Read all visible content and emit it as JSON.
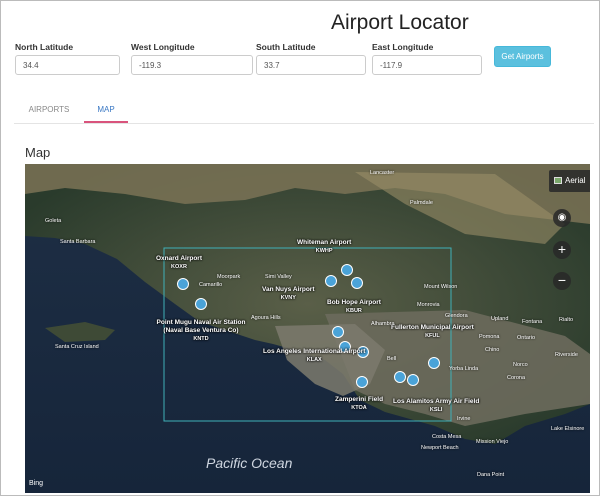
{
  "page": {
    "title": "Airport Locator"
  },
  "fields": [
    {
      "label": "North Latitude",
      "value": "34.4"
    },
    {
      "label": "West Longitude",
      "value": "-119.3"
    },
    {
      "label": "South Latitude",
      "value": "33.7"
    },
    {
      "label": "East Longitude",
      "value": "-117.9"
    }
  ],
  "button": {
    "label": "Get Airports"
  },
  "tabs": [
    {
      "label": "AIRPORTS",
      "active": false
    },
    {
      "label": "MAP",
      "active": true
    }
  ],
  "map": {
    "section_title": "Map",
    "view_button": "Aerial",
    "ocean_label": "Pacific Ocean",
    "attribution": "Bing",
    "airports": [
      {
        "name": "Whiteman Airport",
        "code": "KWHP"
      },
      {
        "name": "Oxnard Airport",
        "code": "KOXR"
      },
      {
        "name": "Van Nuys Airport",
        "code": "KVNY"
      },
      {
        "name": "Bob Hope Airport",
        "code": "KBUR"
      },
      {
        "name": "Point Mugu Naval Air Station (Naval Base Ventura Co)",
        "code": "KNTD"
      },
      {
        "name": "Fullerton Municipal Airport",
        "code": "KFUL"
      },
      {
        "name": "Los Angeles International Airport",
        "code": "KLAX"
      },
      {
        "name": "Zamperini Field",
        "code": "KTOA"
      },
      {
        "name": "Los Alamitos Army Air Field",
        "code": "KSLI"
      }
    ],
    "places": {
      "goleta": "Goleta",
      "santa_barbara": "Santa Barbara",
      "moorpark": "Moorpark",
      "simi_valley": "Simi Valley",
      "camarillo": "Camarillo",
      "agoura_hills": "Agoura Hills",
      "monrovia": "Monrovia",
      "glendora": "Glendora",
      "upland": "Upland",
      "alhambra": "Alhambra",
      "pomona": "Pomona",
      "fontana": "Fontana",
      "rialto": "Rialto",
      "chino": "Chino",
      "ontario": "Ontario",
      "yorba_linda": "Yorba Linda",
      "riverside": "Riverside",
      "norco": "Norco",
      "corona": "Corona",
      "irvine": "Irvine",
      "costa_mesa": "Costa Mesa",
      "mission_viejo": "Mission Viejo",
      "newport_beach": "Newport Beach",
      "dana_point": "Dana Point",
      "lake_elsinore": "Lake Elsinore",
      "palmdale": "Palmdale",
      "lancaster": "Lancaster",
      "santa_cruz_island": "Santa Cruz Island",
      "bell": "Bell",
      "mount_wilson": "Mount Wilson"
    }
  }
}
